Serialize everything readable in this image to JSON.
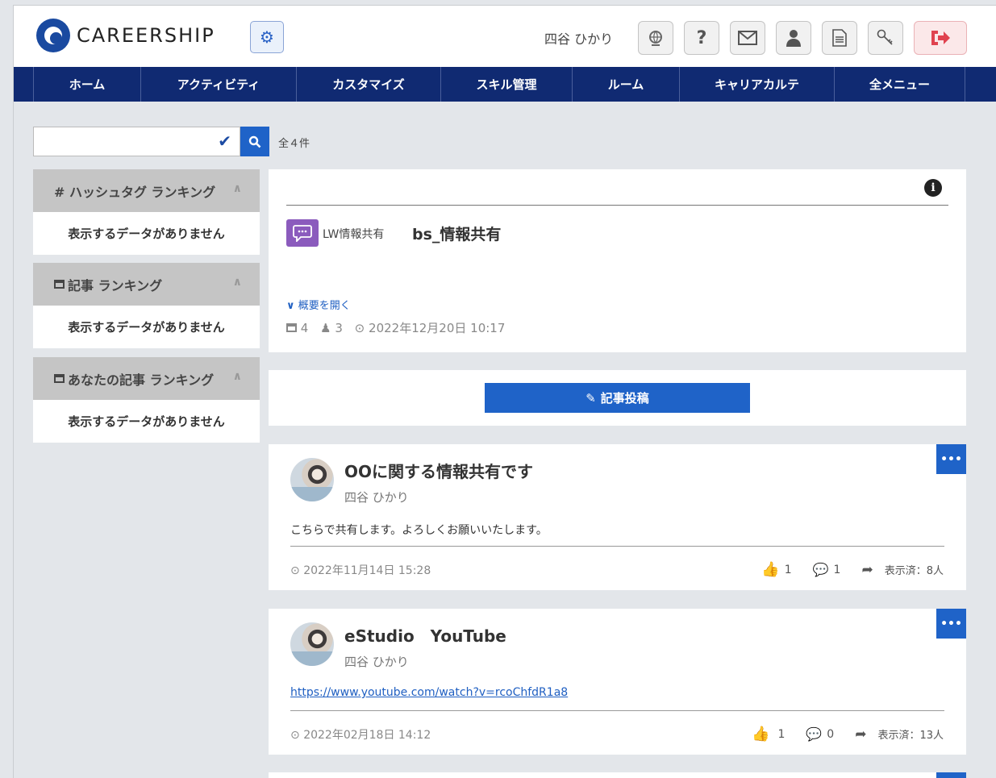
{
  "header": {
    "logo_text": "CAREERSHIP",
    "user_name": "四谷 ひかり"
  },
  "nav": {
    "items": [
      {
        "label": "ホーム"
      },
      {
        "label": "アクティビティ"
      },
      {
        "label": "カスタマイズ"
      },
      {
        "label": "スキル管理"
      },
      {
        "label": "ルーム"
      },
      {
        "label": "キャリアカルテ"
      },
      {
        "label": "全メニュー"
      }
    ]
  },
  "search": {
    "placeholder": "",
    "total": "全４件"
  },
  "sidebar": {
    "rankings": [
      {
        "title": "# ハッシュタグ ランキング",
        "empty": "表示するデータがありません"
      },
      {
        "title": "記事 ランキング",
        "empty": "表示するデータがありません"
      },
      {
        "title": "あなたの記事 ランキング",
        "empty": "表示するデータがありません"
      }
    ]
  },
  "room": {
    "category": "LW情報共有",
    "title": "bs_情報共有",
    "open_summary": "概要を開く",
    "articles": "4",
    "members": "3",
    "date": "2022年12月20日 10:17"
  },
  "post_button": "記事投稿",
  "posts": [
    {
      "title": "OOに関する情報共有です",
      "author": "四谷 ひかり",
      "body": "こちらで共有します。よろしくお願いいたします。",
      "date": "2022年11月14日 15:28",
      "likes": "1",
      "comments": "1",
      "viewed": "表示済：8人"
    },
    {
      "title": "eStudio　YouTube",
      "author": "四谷 ひかり",
      "body": "https://www.youtube.com/watch?v=rcoChfdR1a8",
      "date": "2022年02月18日 14:12",
      "likes": "1",
      "comments": "0",
      "viewed": "表示済：13人"
    }
  ],
  "colors": {
    "nav_bg": "#102a72",
    "accent": "#1f63c8",
    "room_icon": "#8b5bbd",
    "logout": "#e0424f"
  }
}
